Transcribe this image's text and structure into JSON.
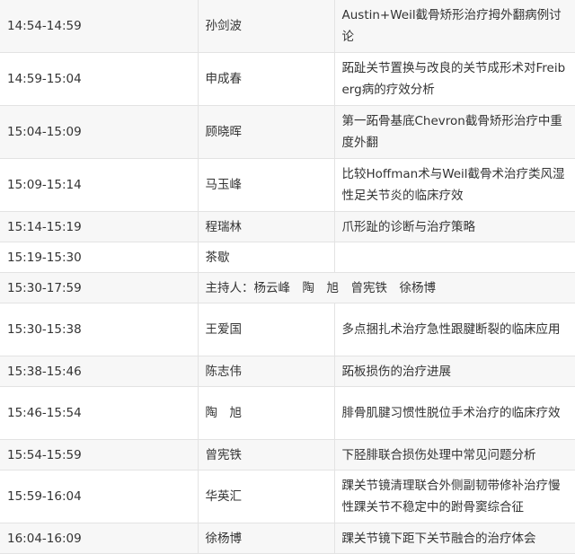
{
  "rows": [
    {
      "time": "14:54-14:59",
      "speaker": "孙剑波",
      "title": "Austin+Weil截骨矫形治疗拇外翻病例讨论",
      "lines": 2,
      "shade": true
    },
    {
      "time": "14:59-15:04",
      "speaker": "申成春",
      "title": "跖趾关节置换与改良的关节成形术对Freiberg病的疗效分析",
      "lines": 2,
      "shade": false
    },
    {
      "time": "15:04-15:09",
      "speaker": "顾晓晖",
      "title": "第一跖骨基底Chevron截骨矫形治疗中重度外翻",
      "lines": 2,
      "shade": true
    },
    {
      "time": "15:09-15:14",
      "speaker": "马玉峰",
      "title": "比较Hoffman术与Weil截骨术治疗类风湿性足关节炎的临床疗效",
      "lines": 2,
      "shade": false
    },
    {
      "time": "15:14-15:19",
      "speaker": "程瑞林",
      "title": "爪形趾的诊断与治疗策略",
      "lines": 1,
      "shade": true
    },
    {
      "time": "15:19-15:30",
      "speaker": "茶歇",
      "title": "",
      "lines": 1,
      "shade": false
    },
    {
      "time": "15:30-17:59",
      "speaker": "主持人：杨云峰　陶　旭　曾宪铁　徐杨博",
      "title": "",
      "lines": 1,
      "shade": true,
      "merged": true
    },
    {
      "time": "15:30-15:38",
      "speaker": "王爱国",
      "title": "多点捆扎术治疗急性跟腱断裂的临床应用",
      "lines": 2,
      "shade": false
    },
    {
      "time": "15:38-15:46",
      "speaker": "陈志伟",
      "title": "跖板损伤的治疗进展",
      "lines": 1,
      "shade": true
    },
    {
      "time": "15:46-15:54",
      "speaker": "陶　旭",
      "title": "腓骨肌腱习惯性脱位手术治疗的临床疗效",
      "lines": 2,
      "shade": false
    },
    {
      "time": "15:54-15:59",
      "speaker": "曾宪铁",
      "title": "下胫腓联合损伤处理中常见问题分析",
      "lines": 1,
      "shade": true
    },
    {
      "time": "15:59-16:04",
      "speaker": "华英汇",
      "title": "踝关节镜清理联合外侧副韧带修补治疗慢性踝关节不稳定中的跗骨窦综合征",
      "lines": 2,
      "shade": false
    },
    {
      "time": "16:04-16:09",
      "speaker": "徐杨博",
      "title": "踝关节镜下距下关节融合的治疗体会",
      "lines": 1,
      "shade": true
    }
  ]
}
